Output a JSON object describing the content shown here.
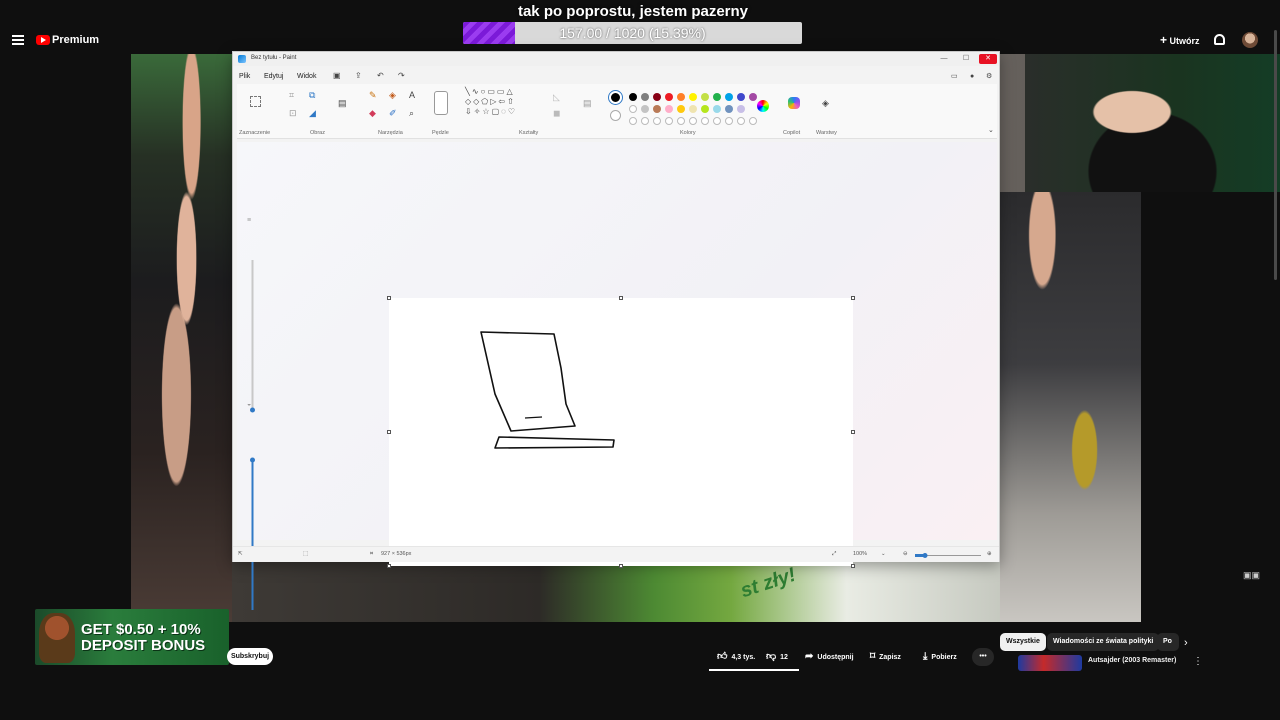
{
  "overlay": {
    "title": "tak po poprostu, jestem pazerny",
    "goal_text": "157.00 / 1020 (15.39%)",
    "goal_progress": 0.1539,
    "goal_color": "#8e2de2"
  },
  "youtube": {
    "brand": "Premium",
    "create_label": "Utwórz",
    "subscribe_label": "Subskrybuj",
    "actions": {
      "likes": "4,3 tys.",
      "dislikes": "12",
      "share": "Udostępnij",
      "save": "Zapisz",
      "download": "Pobierz"
    },
    "chips": [
      "Wszystkie",
      "Wiadomości ze świata polityki",
      "Po"
    ],
    "recommendation": {
      "title": "Autsajder (2003 Remaster)"
    },
    "ad_text": "GET $0.50 + 10% DEPOSIT BONUS"
  },
  "paint": {
    "window_title": "Bez tytułu - Paint",
    "menu": [
      "Plik",
      "Edytuj",
      "Widok"
    ],
    "groups": [
      "Zaznaczenie",
      "Obraz",
      "Narzędzia",
      "Pędzle",
      "Kształty",
      "Kolory",
      "Copilot",
      "Warstwy"
    ],
    "colors_row1": [
      "#000000",
      "#7f7f7f",
      "#880015",
      "#ed1c24",
      "#ff7f27",
      "#fff200",
      "#c3e046",
      "#22b14c",
      "#00a2e8",
      "#3f48cc",
      "#a349a4"
    ],
    "colors_row2": [
      "#ffffff",
      "#c3c3c3",
      "#b97a57",
      "#ffaec9",
      "#ffc90e",
      "#efe4b0",
      "#b5e61d",
      "#99d9ea",
      "#7092be",
      "#c8bfe7"
    ],
    "canvas_size": "927 × 536px",
    "zoom": "100%"
  },
  "sign_text": "st zły!"
}
